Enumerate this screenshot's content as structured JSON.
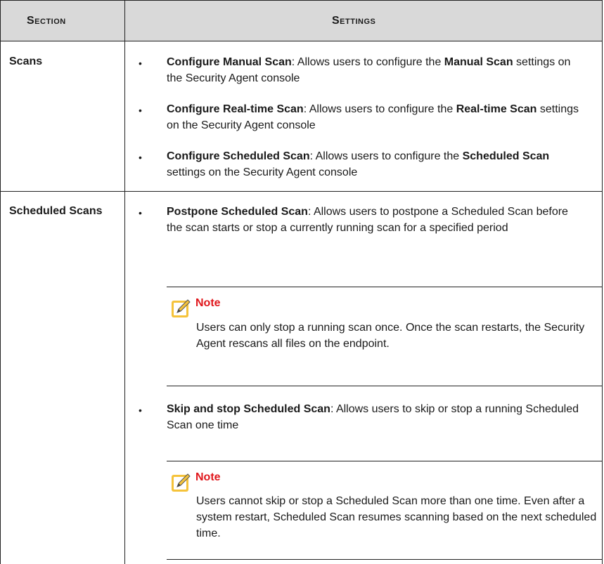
{
  "headers": {
    "section": "Section",
    "settings": "Settings"
  },
  "rows": [
    {
      "section": "Scans",
      "items": [
        {
          "bold": "Configure Manual Scan",
          "rest1": ": Allows users to configure the ",
          "bold2": "Manual Scan",
          "rest2": " settings on the Security Agent console"
        },
        {
          "bold": "Configure Real-time Scan",
          "rest1": ": Allows users to configure the ",
          "bold2": "Real-time Scan",
          "rest2": " settings on the Security Agent console"
        },
        {
          "bold": "Configure Scheduled Scan",
          "rest1": ": Allows users to configure the ",
          "bold2": "Scheduled Scan",
          "rest2": " settings on the Security Agent console"
        }
      ]
    },
    {
      "section": "Scheduled Scans",
      "items": [
        {
          "bold": "Postpone Scheduled Scan",
          "rest1": ": Allows users to postpone a Scheduled Scan before the scan starts or stop a currently running scan for a specified period"
        },
        {
          "bold": "Skip and stop Scheduled Scan",
          "rest1": ": Allows users to skip or stop a running Scheduled Scan one time"
        }
      ],
      "notes": [
        {
          "title": "Note",
          "body": "Users can only stop a running scan once. Once the scan restarts, the Security Agent rescans all files on the endpoint."
        },
        {
          "title": "Note",
          "body": "Users cannot skip or stop a Scheduled Scan more than one time. Even after a system restart, Scheduled Scan resumes scanning based on the next scheduled time."
        }
      ]
    }
  ],
  "bullet_glyph": "•",
  "colors": {
    "header_bg": "#d9d9d9",
    "note_title": "#e0161b",
    "note_icon": "#f5c33b"
  }
}
